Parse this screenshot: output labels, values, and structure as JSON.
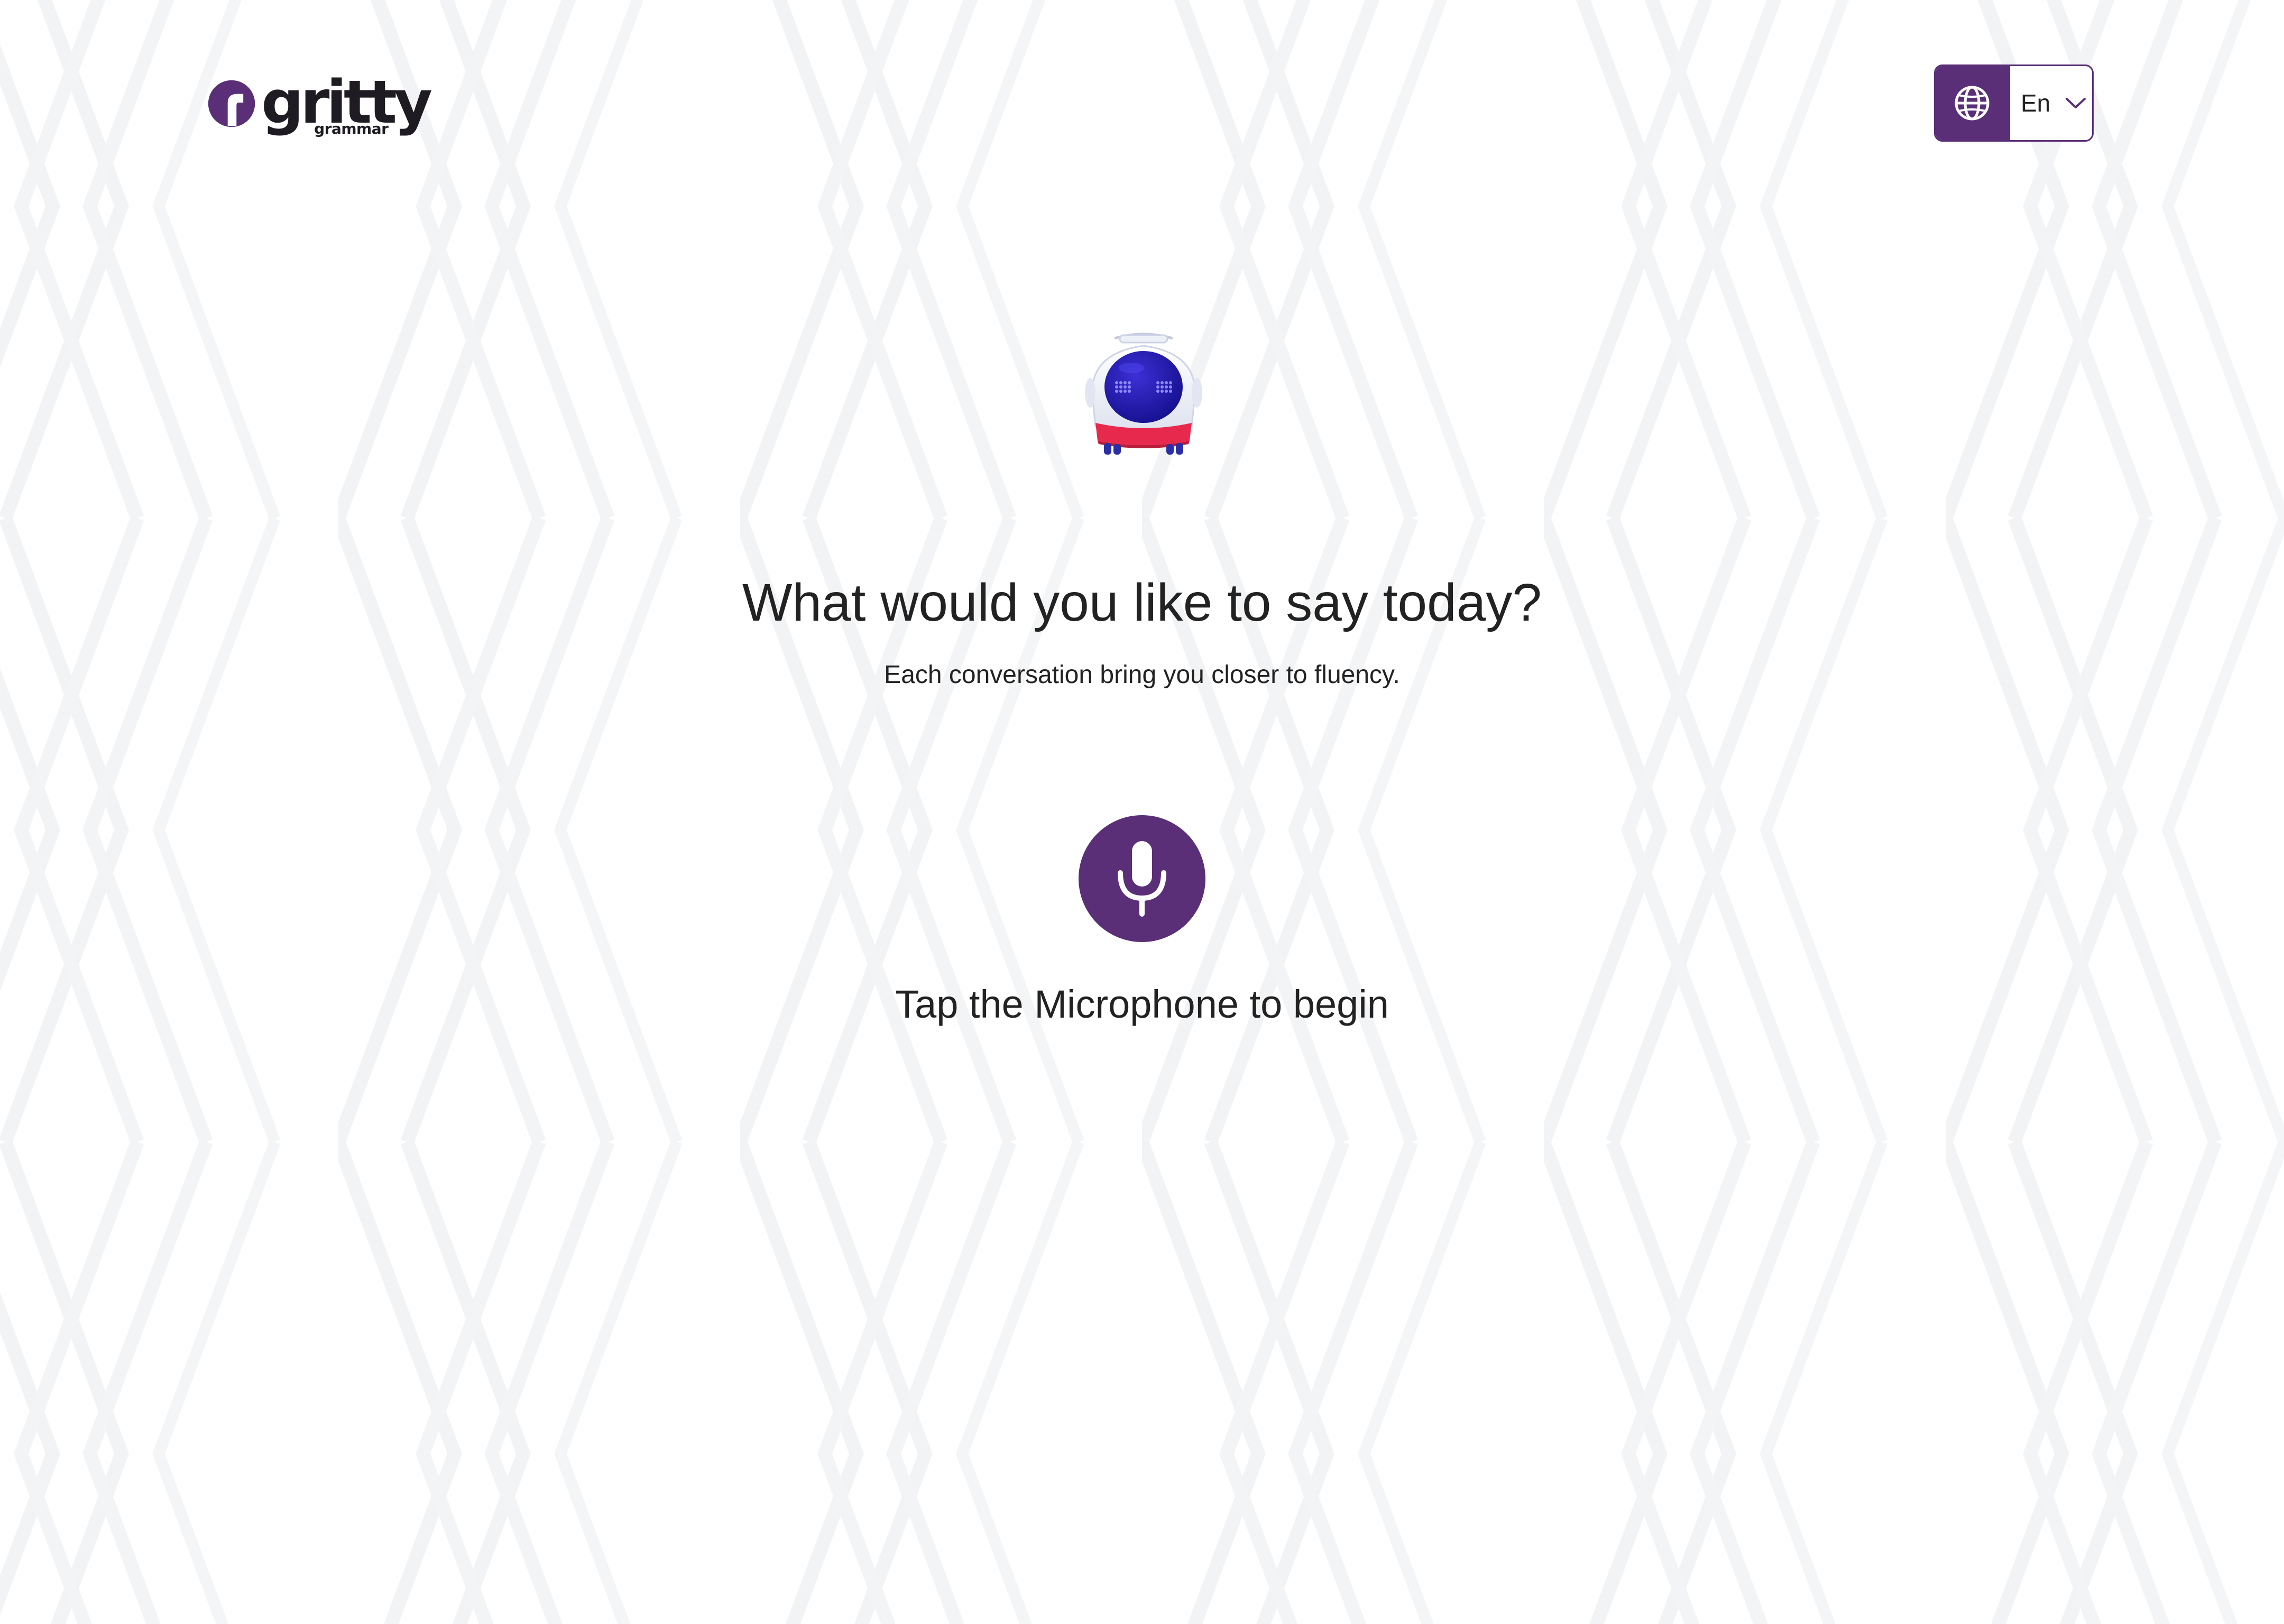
{
  "brand": {
    "name": "gritty",
    "subname": "grammar",
    "color": "#5a2f78"
  },
  "language_switch": {
    "label": "En",
    "icon": "globe-icon",
    "chevron": "chevron-down-icon"
  },
  "main": {
    "mascot": "robot-mascot",
    "headline": "What would you like to say today?",
    "subheadline": "Each conversation bring you closer to fluency.",
    "mic_icon": "microphone-icon",
    "prompt": "Tap the Microphone to begin"
  },
  "colors": {
    "accent": "#5a2f78",
    "text": "#222222",
    "background": "#ffffff",
    "pattern": "#f2f3f5"
  }
}
